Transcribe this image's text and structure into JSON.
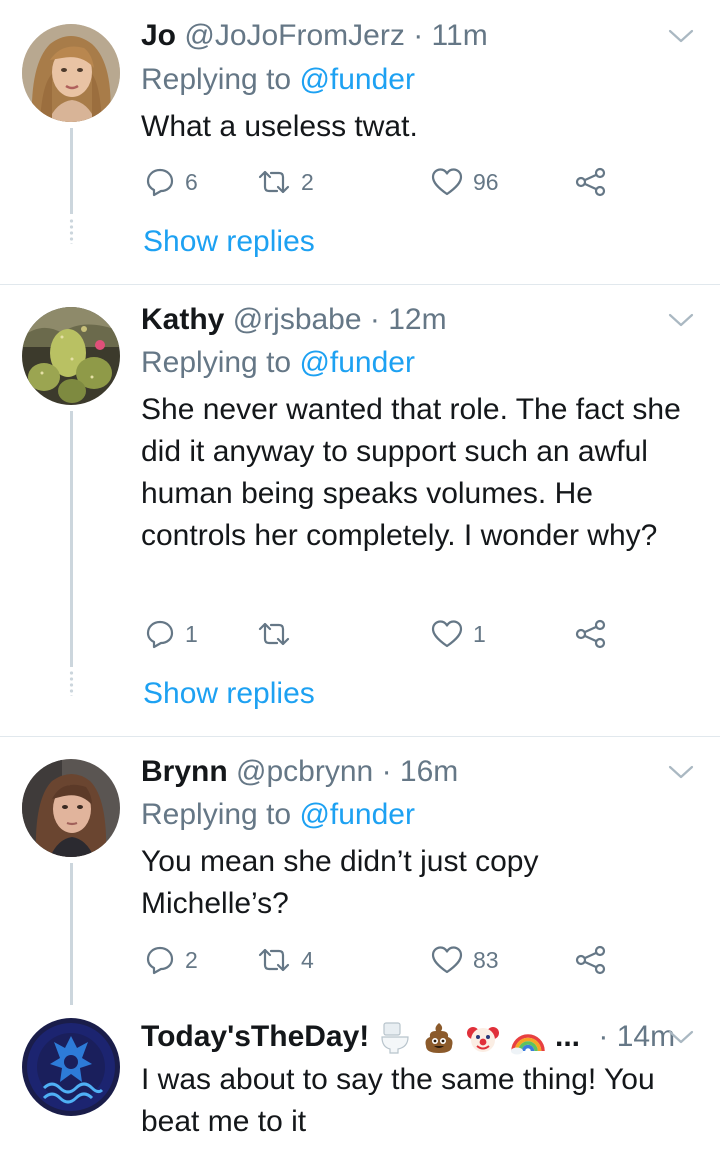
{
  "replies": [
    {
      "name": "Jo",
      "handle": "@JoJoFromJerz",
      "separator": "·",
      "time": "11m",
      "replying_prefix": "Replying to ",
      "replying_to": "@funder",
      "text": "What a useless twat.",
      "reply_count": "6",
      "retweet_count": "2",
      "like_count": "96",
      "show_replies": "Show replies"
    },
    {
      "name": "Kathy",
      "handle": "@rjsbabe",
      "separator": "·",
      "time": "12m",
      "replying_prefix": "Replying to ",
      "replying_to": "@funder",
      "text": "She never wanted that role. The fact she did it anyway to support such an awful human being speaks volumes. He controls her completely. I wonder why?",
      "reply_count": "1",
      "retweet_count": "",
      "like_count": "1",
      "show_replies": "Show replies"
    },
    {
      "name": "Brynn",
      "handle": "@pcbrynn",
      "separator": "·",
      "time": "16m",
      "replying_prefix": "Replying to ",
      "replying_to": "@funder",
      "text": "You mean she didn’t just copy Michelle’s?",
      "reply_count": "2",
      "retweet_count": "4",
      "like_count": "83"
    },
    {
      "name": "Today'sTheDay!",
      "name_emoji": [
        "toilet-emoji",
        "poop-emoji",
        "clown-emoji",
        "rainbow-emoji"
      ],
      "ellipsis": "...",
      "separator": "·",
      "time": "14m",
      "text": "I was about to say the same thing!  You beat me to it"
    }
  ],
  "icons": [
    "reply-icon",
    "retweet-icon",
    "like-icon",
    "share-icon",
    "chevron-down-icon"
  ],
  "colors": {
    "text": "#14171a",
    "secondary": "#657786",
    "link": "#1da1f2",
    "divider": "#e1e8ed",
    "thread_line": "#ccd6dd"
  }
}
